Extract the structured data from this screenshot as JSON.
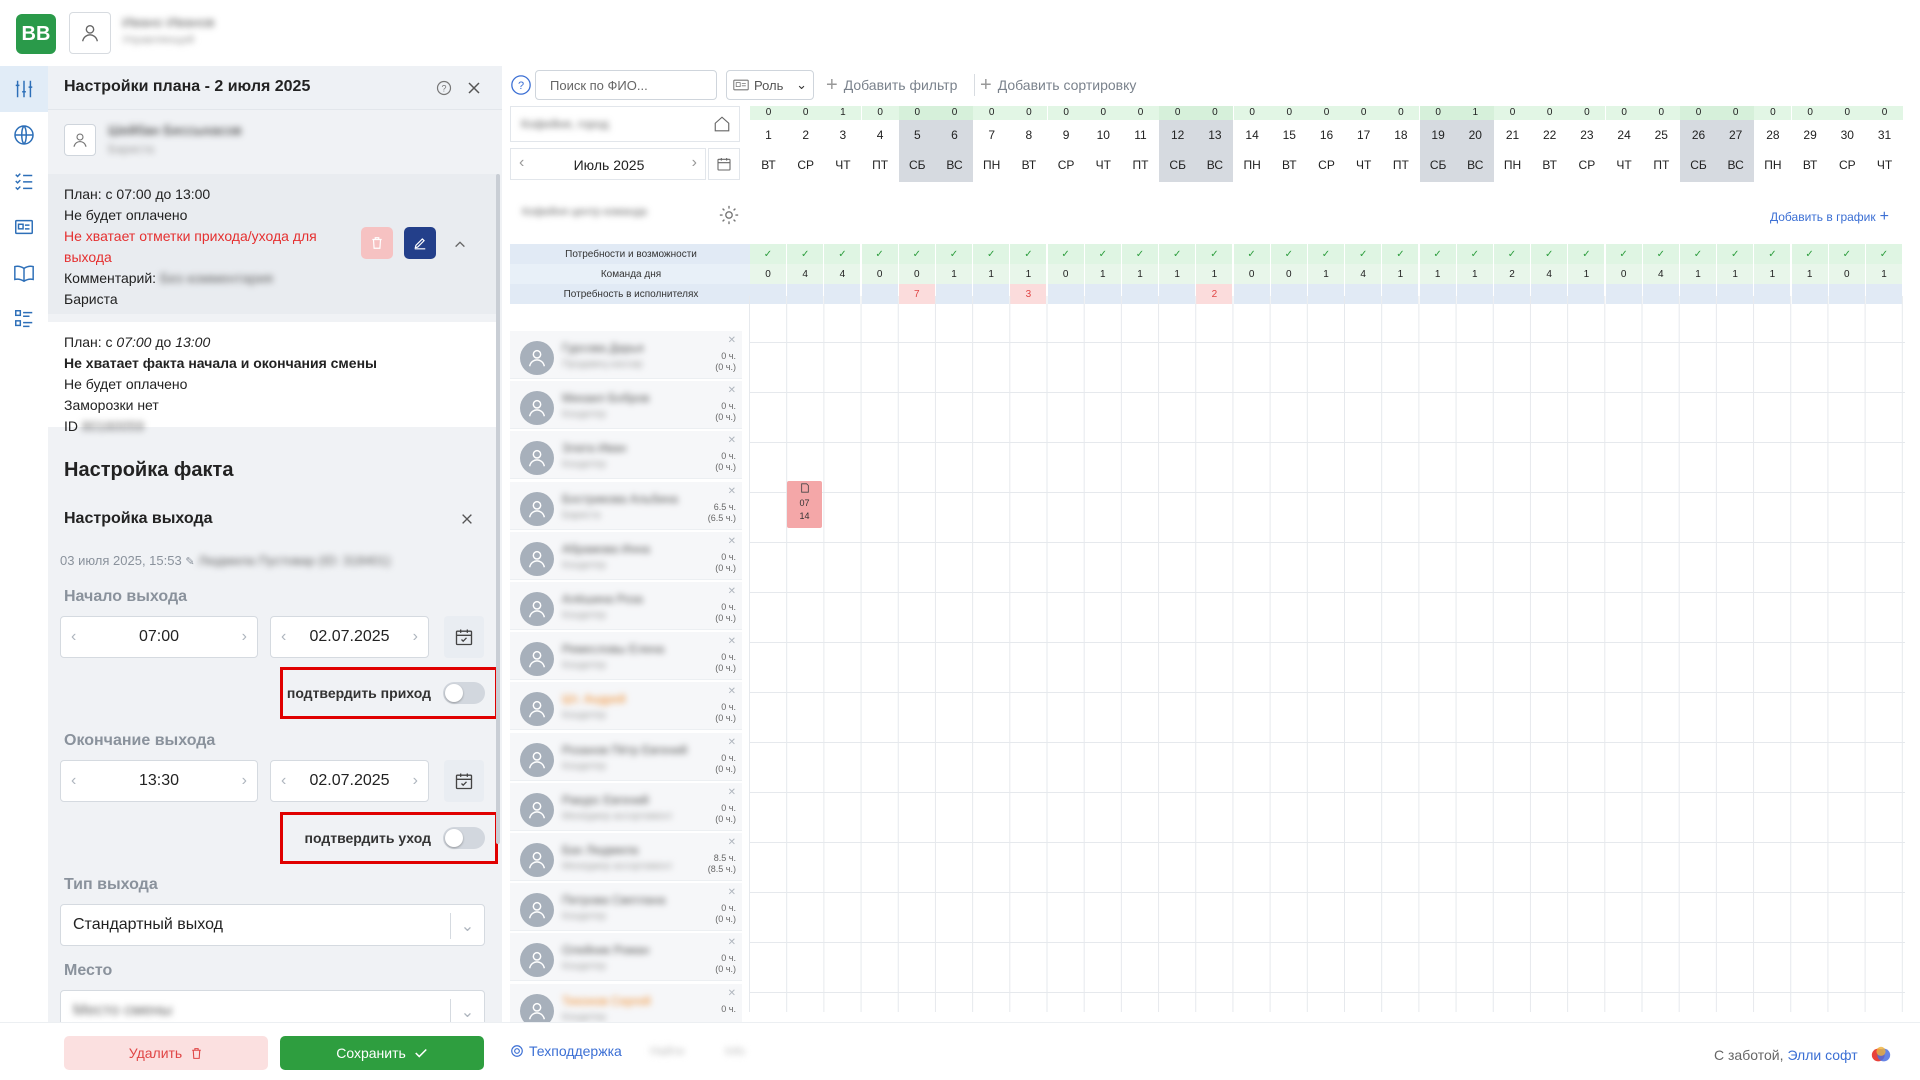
{
  "app": {
    "logo_text": "BB",
    "user_name": "Ивано Иванов",
    "user_role": "Управляющий"
  },
  "panel": {
    "title": "Настройки плана - 2 июля 2025",
    "employee_name": "Шейбан Бессыхасов",
    "employee_role": "Бариста",
    "plan_card": {
      "plan_line": "План: с 07:00 до 13:00",
      "not_paid": "Не будет оплачено",
      "missing_mark": "Не хватает отметки прихода/ухода для выхода",
      "comment_label": "Комментарий:",
      "comment_value": "Без комментария",
      "role": "Бариста"
    },
    "fact_card": {
      "plan_prefix": "План: с ",
      "plan_from": "07:00",
      "plan_mid": " до ",
      "plan_to": "13:00",
      "missing_fact": "Не хватает факта начала и окончания смены",
      "not_paid": "Не будет оплачено",
      "freeze": "Заморозки нет",
      "id_label": "ID",
      "id_value": "80160059"
    },
    "fact_section_title": "Настройка факта",
    "exit_section_title": "Настройка выхода",
    "edit_meta": "03 июля 2025, 15:53",
    "edit_author": "Людмила Пустовар (ID: 318401)",
    "start": {
      "label": "Начало выхода",
      "time": "07:00",
      "date": "02.07.2025",
      "confirm_label": "подтвердить приход"
    },
    "end": {
      "label": "Окончание выхода",
      "time": "13:30",
      "date": "02.07.2025",
      "confirm_label": "подтвердить уход"
    },
    "type": {
      "label": "Тип выхода",
      "value": "Стандартный выход"
    },
    "place": {
      "label": "Место",
      "value": "Место смены"
    }
  },
  "footer": {
    "delete_label": "Удалить",
    "save_label": "Сохранить",
    "support_label": "Техподдержка",
    "misc1": "Найти",
    "misc2": "Info",
    "credit_prefix": "С заботой, ",
    "credit_brand": "Элли софт"
  },
  "toolbar": {
    "search_placeholder": "Поиск по ФИО...",
    "role_label": "Роль",
    "add_filter": "Добавить фильтр",
    "add_sort": "Добавить сортировку"
  },
  "schedule": {
    "location": "Кофейня, город",
    "month": "Июль 2025",
    "team_label": "Кофейня центр команда",
    "add_to_schedule": "Добавить в график",
    "row_labels": [
      "Потребности и возможности",
      "Команда дня",
      "Потребность в исполнителях"
    ],
    "days": [
      {
        "d": "1",
        "w": "ВТ",
        "c": "0",
        "team": "0",
        "need": ""
      },
      {
        "d": "2",
        "w": "СР",
        "c": "0",
        "team": "4",
        "need": ""
      },
      {
        "d": "3",
        "w": "ЧТ",
        "c": "1",
        "team": "4",
        "need": ""
      },
      {
        "d": "4",
        "w": "ПТ",
        "c": "0",
        "team": "0",
        "need": ""
      },
      {
        "d": "5",
        "w": "СБ",
        "c": "0",
        "team": "0",
        "need": "7",
        "we": true
      },
      {
        "d": "6",
        "w": "ВС",
        "c": "0",
        "team": "1",
        "need": "",
        "we": true
      },
      {
        "d": "7",
        "w": "ПН",
        "c": "0",
        "team": "1",
        "need": ""
      },
      {
        "d": "8",
        "w": "ВТ",
        "c": "0",
        "team": "1",
        "need": "3"
      },
      {
        "d": "9",
        "w": "СР",
        "c": "0",
        "team": "0",
        "need": ""
      },
      {
        "d": "10",
        "w": "ЧТ",
        "c": "0",
        "team": "1",
        "need": ""
      },
      {
        "d": "11",
        "w": "ПТ",
        "c": "0",
        "team": "1",
        "need": ""
      },
      {
        "d": "12",
        "w": "СБ",
        "c": "0",
        "team": "1",
        "need": "",
        "we": true
      },
      {
        "d": "13",
        "w": "ВС",
        "c": "0",
        "team": "1",
        "need": "2",
        "we": true
      },
      {
        "d": "14",
        "w": "ПН",
        "c": "0",
        "team": "0",
        "need": ""
      },
      {
        "d": "15",
        "w": "ВТ",
        "c": "0",
        "team": "0",
        "need": ""
      },
      {
        "d": "16",
        "w": "СР",
        "c": "0",
        "team": "1",
        "need": ""
      },
      {
        "d": "17",
        "w": "ЧТ",
        "c": "0",
        "team": "4",
        "need": ""
      },
      {
        "d": "18",
        "w": "ПТ",
        "c": "0",
        "team": "1",
        "need": ""
      },
      {
        "d": "19",
        "w": "СБ",
        "c": "0",
        "team": "1",
        "need": "",
        "we": true
      },
      {
        "d": "20",
        "w": "ВС",
        "c": "1",
        "team": "1",
        "need": "",
        "we": true
      },
      {
        "d": "21",
        "w": "ПН",
        "c": "0",
        "team": "2",
        "need": ""
      },
      {
        "d": "22",
        "w": "ВТ",
        "c": "0",
        "team": "4",
        "need": ""
      },
      {
        "d": "23",
        "w": "СР",
        "c": "0",
        "team": "1",
        "need": ""
      },
      {
        "d": "24",
        "w": "ЧТ",
        "c": "0",
        "team": "0",
        "need": ""
      },
      {
        "d": "25",
        "w": "ПТ",
        "c": "0",
        "team": "4",
        "need": ""
      },
      {
        "d": "26",
        "w": "СБ",
        "c": "0",
        "team": "1",
        "need": "",
        "we": true
      },
      {
        "d": "27",
        "w": "ВС",
        "c": "0",
        "team": "1",
        "need": "",
        "we": true
      },
      {
        "d": "28",
        "w": "ПН",
        "c": "0",
        "team": "1",
        "need": ""
      },
      {
        "d": "29",
        "w": "ВТ",
        "c": "0",
        "team": "1",
        "need": ""
      },
      {
        "d": "30",
        "w": "СР",
        "c": "0",
        "team": "0",
        "need": ""
      },
      {
        "d": "31",
        "w": "ЧТ",
        "c": "0",
        "team": "1",
        "need": ""
      }
    ],
    "employees": [
      {
        "name": "Гурсова Дарья",
        "role": "Продавец-кассир",
        "h1": "0 ч.",
        "h2": "(0 ч.)"
      },
      {
        "name": "Михаил Бобров",
        "role": "Кондитер",
        "h1": "0 ч.",
        "h2": "(0 ч.)"
      },
      {
        "name": "Злата Иван",
        "role": "Кондитер",
        "h1": "0 ч.",
        "h2": "(0 ч.)"
      },
      {
        "name": "Бострикова Альбина",
        "role": "Бариста",
        "h1": "6.5 ч.",
        "h2": "(6.5 ч.)"
      },
      {
        "name": "Абрамова Инна",
        "role": "Кондитер",
        "h1": "0 ч.",
        "h2": "(0 ч.)"
      },
      {
        "name": "Алёшина Роза",
        "role": "Кондитер",
        "h1": "0 ч.",
        "h2": "(0 ч.)"
      },
      {
        "name": "Ремесловы Елена",
        "role": "Кондитер",
        "h1": "0 ч.",
        "h2": "(0 ч.)"
      },
      {
        "name": "Шт. Андрей",
        "role": "Кондитер",
        "h1": "0 ч.",
        "h2": "(0 ч.)",
        "orange": true
      },
      {
        "name": "Розанов Пётр Евгений",
        "role": "Кондитер",
        "h1": "0 ч.",
        "h2": "(0 ч.)"
      },
      {
        "name": "Ракурс Евгений",
        "role": "Менеджер ассортимента",
        "h1": "0 ч.",
        "h2": "(0 ч.)"
      },
      {
        "name": "Бах Людмила",
        "role": "Менеджер ассортимента",
        "h1": "8.5 ч.",
        "h2": "(8.5 ч.)"
      },
      {
        "name": "Петрова Светлана",
        "role": "Кондитер",
        "h1": "0 ч.",
        "h2": "(0 ч.)"
      },
      {
        "name": "Олейник Роман",
        "role": "Кондитер",
        "h1": "0 ч.",
        "h2": "(0 ч.)"
      },
      {
        "name": "Тихонов Сергей",
        "role": "Кондитер",
        "h1": "0 ч.",
        "h2": "",
        "orange": true
      }
    ],
    "shift": {
      "start": "07",
      "end": "14"
    }
  },
  "colors": {
    "brand_green": "#2a9a4a",
    "save_green": "#2e9e3f",
    "danger": "#e00000",
    "edit_blue": "#233f8a",
    "link_blue": "#3b6fd4"
  }
}
